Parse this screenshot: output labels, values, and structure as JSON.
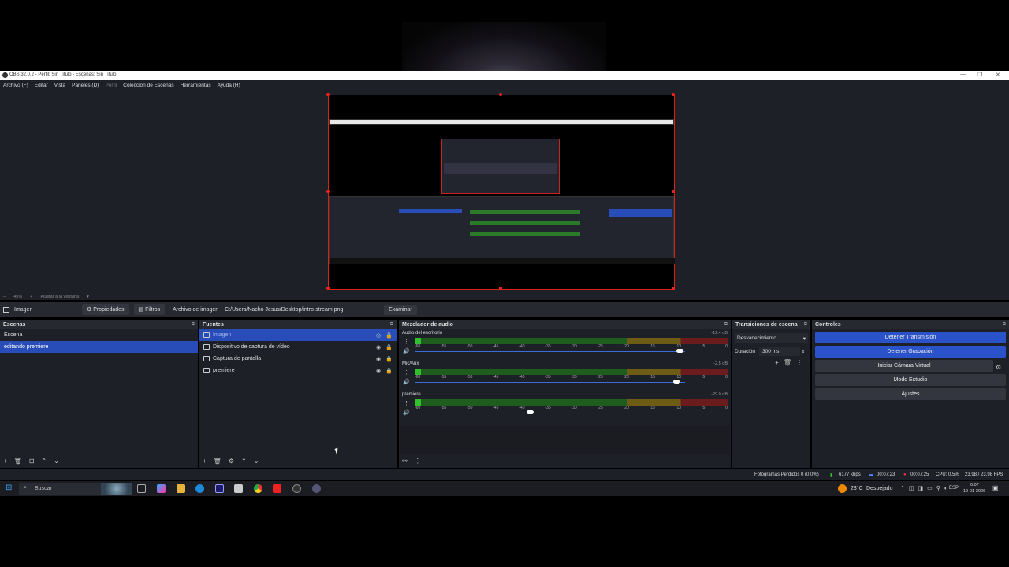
{
  "window": {
    "title": "OBS 32.0.2 - Perfil: Sin Título - Escenas: Sin Título",
    "minimize": "—",
    "maximize": "❐",
    "close": "✕"
  },
  "menu": [
    "Archivo (F)",
    "Editar",
    "Vista",
    "Paneles (D)",
    "Perfil",
    "Colección de Escenas",
    "Herramientas",
    "Ayuda (H)"
  ],
  "zoom": {
    "percent": "45%",
    "fit_label": "Ajustar a la ventana"
  },
  "props_bar": {
    "source_name": "Imagen",
    "properties_label": "Propiedades",
    "filters_label": "Filtros",
    "file_label": "Archivo de imagen",
    "file_path": "C:/Users/Nacho Jesus/Desktop/intro-stream.png",
    "browse_label": "Examinar"
  },
  "scenes": {
    "title": "Escenas",
    "items": [
      "Escena",
      "editando premiere"
    ],
    "selected_index": 1
  },
  "sources": {
    "title": "Fuentes",
    "items": [
      "Imagen",
      "Dispositivo de captura de vídeo",
      "Captura de pantalla",
      "premiere"
    ],
    "selected_index": 0
  },
  "mixer": {
    "title": "Mezclador de audio",
    "ticks": [
      "-60",
      "-55",
      "-50",
      "-45",
      "-40",
      "-35",
      "-30",
      "-25",
      "-20",
      "-15",
      "-10",
      "-5",
      "0"
    ],
    "channels": [
      {
        "name": "Audio del escritorio",
        "db": "-12.4 dB",
        "level": 0.02,
        "volume": 0.99
      },
      {
        "name": "Mic/Aux",
        "db": "-2.5 dB",
        "level": 0.0,
        "volume": 0.98
      },
      {
        "name": "premiere",
        "db": "-29.0 dB",
        "level": 0.0,
        "volume": 0.43
      }
    ]
  },
  "transitions": {
    "title": "Transiciones de escena",
    "transition": "Desvanecimiento",
    "duration_label": "Duración",
    "duration_value": "300 ms"
  },
  "controls": {
    "title": "Controles",
    "buttons": [
      "Detener Transmisión",
      "Detener Grabación",
      "Iniciar Cámara Virtual",
      "Modo Estudio",
      "Ajustes"
    ]
  },
  "status": {
    "dropped": "Fotogramas Perdidos 0 (0.0%)",
    "bitrate": "6177 kbps",
    "stream_time": "00:07:23",
    "rec_time": "00:07:25",
    "cpu": "CPU: 0.5%",
    "fps": "23.98 / 23.98 FPS"
  },
  "taskbar": {
    "search": "Buscar",
    "weather_temp": "23°C",
    "weather_desc": "Despejado",
    "lang": "ESP",
    "time": "0:07",
    "date": "19-01-2026"
  },
  "colors": {
    "accent": "#284cb8",
    "meter_green": "#2fbf2f",
    "selection_border": "#dd2222"
  }
}
